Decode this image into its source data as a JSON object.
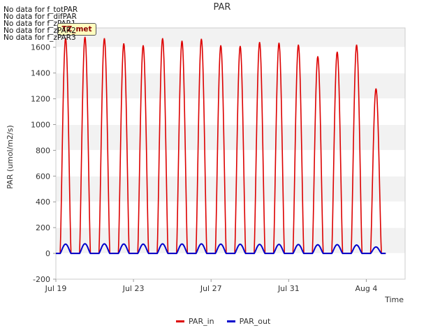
{
  "notes": [
    "No data for f_totPAR",
    "No data for f_difPAR",
    "No data for f_zPAR1",
    "No data for f_zPAR2",
    "No data for f_zPAR3"
  ],
  "badge_label": "TZ_met",
  "colors": {
    "par_in": "#dd0000",
    "par_out": "#0000cc",
    "band": "#f2f2f2",
    "grid": "#ffffff",
    "axis": "#cccccc"
  },
  "chart_data": {
    "type": "line",
    "title": "PAR",
    "xlabel": "Time",
    "ylabel": "PAR (umol/m2/s)",
    "ylim": [
      -200,
      1750
    ],
    "yticks": [
      -200,
      0,
      200,
      400,
      600,
      800,
      1000,
      1200,
      1400,
      1600
    ],
    "xlim": [
      "2024-07-19",
      "2024-08-06"
    ],
    "xticks": [
      {
        "date": "2024-07-19",
        "label": "Jul 19"
      },
      {
        "date": "2024-07-23",
        "label": "Jul 23"
      },
      {
        "date": "2024-07-27",
        "label": "Jul 27"
      },
      {
        "date": "2024-07-31",
        "label": "Jul 31"
      },
      {
        "date": "2024-08-04",
        "label": "Aug 4"
      }
    ],
    "grid": true,
    "legend": "bottom",
    "series": [
      {
        "name": "PAR_in",
        "daily_peaks": [
          {
            "date": "2024-07-19",
            "peak": 1670
          },
          {
            "date": "2024-07-20",
            "peak": 1680
          },
          {
            "date": "2024-07-21",
            "peak": 1670
          },
          {
            "date": "2024-07-22",
            "peak": 1630
          },
          {
            "date": "2024-07-23",
            "peak": 1615
          },
          {
            "date": "2024-07-24",
            "peak": 1670
          },
          {
            "date": "2024-07-25",
            "peak": 1650
          },
          {
            "date": "2024-07-26",
            "peak": 1665
          },
          {
            "date": "2024-07-27",
            "peak": 1615
          },
          {
            "date": "2024-07-28",
            "peak": 1610
          },
          {
            "date": "2024-07-29",
            "peak": 1640
          },
          {
            "date": "2024-07-30",
            "peak": 1635
          },
          {
            "date": "2024-07-31",
            "peak": 1620
          },
          {
            "date": "2024-08-01",
            "peak": 1530
          },
          {
            "date": "2024-08-02",
            "peak": 1565
          },
          {
            "date": "2024-08-03",
            "peak": 1620
          },
          {
            "date": "2024-08-04",
            "peak": 1280
          }
        ]
      },
      {
        "name": "PAR_out",
        "daily_peaks": [
          {
            "date": "2024-07-19",
            "peak": 72
          },
          {
            "date": "2024-07-20",
            "peak": 75
          },
          {
            "date": "2024-07-21",
            "peak": 74
          },
          {
            "date": "2024-07-22",
            "peak": 73
          },
          {
            "date": "2024-07-23",
            "peak": 72
          },
          {
            "date": "2024-07-24",
            "peak": 74
          },
          {
            "date": "2024-07-25",
            "peak": 73
          },
          {
            "date": "2024-07-26",
            "peak": 74
          },
          {
            "date": "2024-07-27",
            "peak": 72
          },
          {
            "date": "2024-07-28",
            "peak": 71
          },
          {
            "date": "2024-07-29",
            "peak": 70
          },
          {
            "date": "2024-07-30",
            "peak": 70
          },
          {
            "date": "2024-07-31",
            "peak": 69
          },
          {
            "date": "2024-08-01",
            "peak": 67
          },
          {
            "date": "2024-08-02",
            "peak": 68
          },
          {
            "date": "2024-08-03",
            "peak": 65
          },
          {
            "date": "2024-08-04",
            "peak": 50
          }
        ]
      }
    ]
  }
}
